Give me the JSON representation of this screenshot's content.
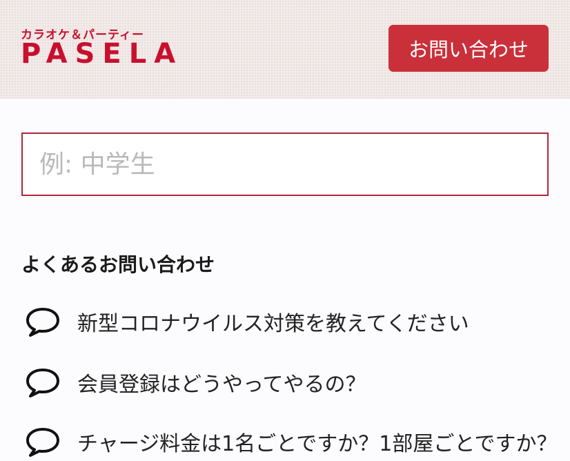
{
  "header": {
    "logo_subtitle": "カラオケ＆パーティー",
    "logo_title": "PASELA",
    "contact_button_label": "お問い合わせ"
  },
  "search": {
    "placeholder": "例: 中学生",
    "value": ""
  },
  "faq": {
    "heading": "よくあるお問い合わせ",
    "icon": "speech-bubble-icon",
    "items": [
      {
        "label": "新型コロナウイルス対策を教えてください"
      },
      {
        "label": "会員登録はどうやってやるの？"
      },
      {
        "label": "チャージ料金は1名ごとですか？1部屋ごとですか？"
      }
    ]
  },
  "colors": {
    "brand": "#c8102e",
    "button": "#c9303a",
    "input_border": "#b0243a"
  }
}
